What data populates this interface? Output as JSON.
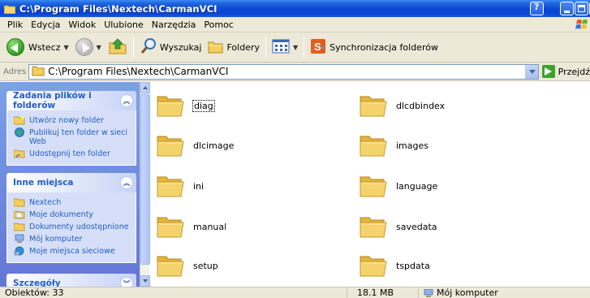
{
  "window": {
    "title": "C:\\Program Files\\Nextech\\CarmanVCI"
  },
  "menu": [
    "Plik",
    "Edycja",
    "Widok",
    "Ulubione",
    "Narzędzia",
    "Pomoc"
  ],
  "toolbar": {
    "back_label": "Wstecz",
    "search_label": "Wyszukaj",
    "folders_label": "Foldery",
    "sync_label": "Synchronizacja folderów"
  },
  "address": {
    "label": "Adres",
    "value": "C:\\Program Files\\Nextech\\CarmanVCI",
    "go_label": "Przejdź"
  },
  "tasks_panel": {
    "title": "Zadania plików i folderów",
    "items": [
      {
        "label": "Utwórz nowy folder",
        "icon": "new-folder-icon"
      },
      {
        "label": "Publikuj ten folder w sieci Web",
        "icon": "publish-web-icon"
      },
      {
        "label": "Udostępnij ten folder",
        "icon": "share-folder-icon"
      }
    ]
  },
  "places_panel": {
    "title": "Inne miejsca",
    "items": [
      {
        "label": "Nextech",
        "icon": "folder-icon"
      },
      {
        "label": "Moje dokumenty",
        "icon": "my-documents-icon"
      },
      {
        "label": "Dokumenty udostępnione",
        "icon": "shared-documents-icon"
      },
      {
        "label": "Mój komputer",
        "icon": "my-computer-icon"
      },
      {
        "label": "Moje miejsca sieciowe",
        "icon": "network-places-icon"
      }
    ]
  },
  "details_panel": {
    "title": "Szczegóły"
  },
  "files": [
    {
      "name": "diag",
      "selected": true
    },
    {
      "name": "dlcdbindex",
      "selected": false
    },
    {
      "name": "dlcimage",
      "selected": false
    },
    {
      "name": "images",
      "selected": false
    },
    {
      "name": "ini",
      "selected": false
    },
    {
      "name": "language",
      "selected": false
    },
    {
      "name": "manual",
      "selected": false
    },
    {
      "name": "savedata",
      "selected": false
    },
    {
      "name": "setup",
      "selected": false
    },
    {
      "name": "tspdata",
      "selected": false
    }
  ],
  "status": {
    "object_count": "Obiektów: 33",
    "size": "18.1 MB",
    "location": "Mój komputer"
  },
  "colors": {
    "titlebar": "#0a46d0",
    "taskpane_link": "#215dc6",
    "folder_yellow": "#f5d36c"
  }
}
